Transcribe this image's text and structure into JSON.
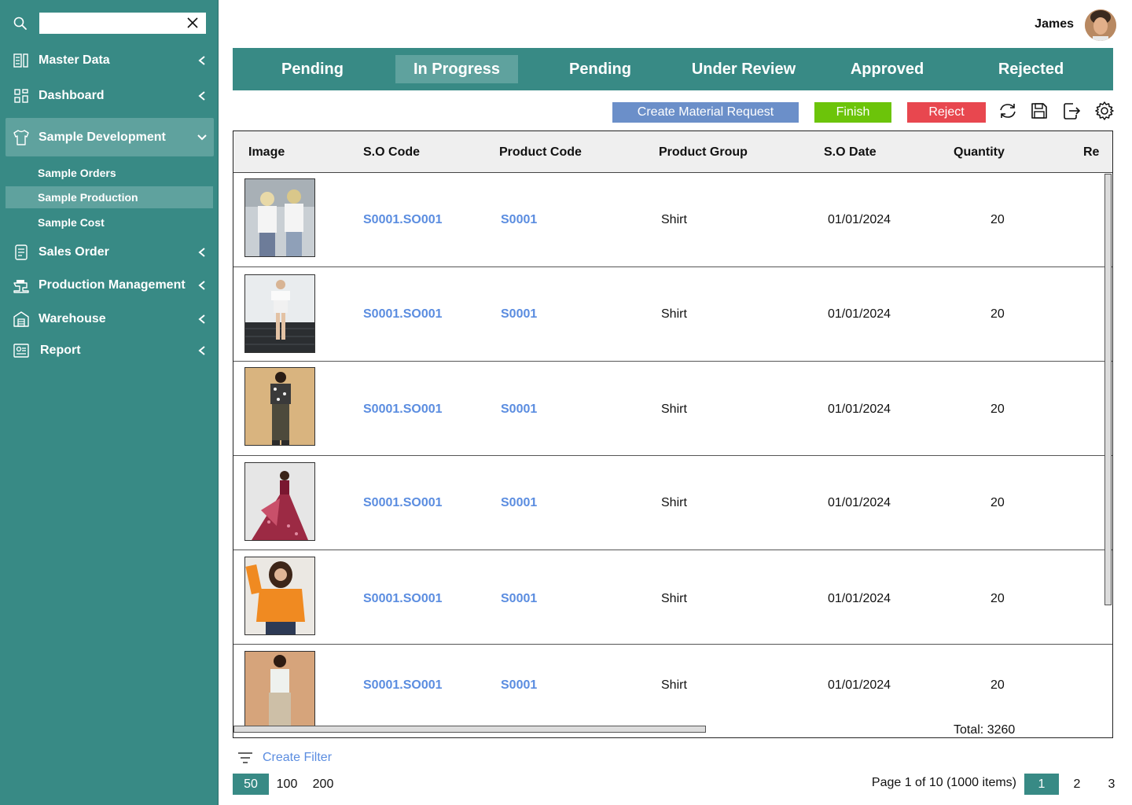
{
  "search": {
    "value": "",
    "placeholder": ""
  },
  "sidebar": {
    "items": [
      {
        "label": "Master Data",
        "icon": "master-data-icon"
      },
      {
        "label": "Dashboard",
        "icon": "dashboard-icon"
      },
      {
        "label": "Sample Development",
        "icon": "shirt-icon"
      },
      {
        "label": "Sales Order",
        "icon": "document-icon"
      },
      {
        "label": "Production Management",
        "icon": "sewing-machine-icon"
      },
      {
        "label": "Warehouse",
        "icon": "warehouse-icon"
      },
      {
        "label": "Report",
        "icon": "report-icon"
      }
    ],
    "sub_items": [
      {
        "label": "Sample Orders"
      },
      {
        "label": "Sample Production"
      },
      {
        "label": "Sample Cost"
      }
    ]
  },
  "header": {
    "user_name": "James"
  },
  "tabs": [
    {
      "label": "Pending"
    },
    {
      "label": "In Progress"
    },
    {
      "label": "Pending"
    },
    {
      "label": "Under Review"
    },
    {
      "label": "Approved"
    },
    {
      "label": "Rejected"
    }
  ],
  "actions": {
    "create_label": "Create Material Request",
    "finish_label": "Finish",
    "reject_label": "Reject"
  },
  "colors": {
    "brand": "#388a85",
    "brand_light": "#5fa29e",
    "create": "#6b8fc9",
    "finish": "#6cc40a",
    "reject": "#e8474f",
    "link": "#5b8de0"
  },
  "table": {
    "columns": [
      "Image",
      "S.O Code",
      "Product Code",
      "Product Group",
      "S.O Date",
      "Quantity",
      "Re"
    ],
    "rows": [
      {
        "so_code": "S0001.SO001",
        "product_code": "S0001",
        "group": "Shirt",
        "date": "01/01/2024",
        "qty": "20"
      },
      {
        "so_code": "S0001.SO001",
        "product_code": "S0001",
        "group": "Shirt",
        "date": "01/01/2024",
        "qty": "20"
      },
      {
        "so_code": "S0001.SO001",
        "product_code": "S0001",
        "group": "Shirt",
        "date": "01/01/2024",
        "qty": "20"
      },
      {
        "so_code": "S0001.SO001",
        "product_code": "S0001",
        "group": "Shirt",
        "date": "01/01/2024",
        "qty": "20"
      },
      {
        "so_code": "S0001.SO001",
        "product_code": "S0001",
        "group": "Shirt",
        "date": "01/01/2024",
        "qty": "20"
      },
      {
        "so_code": "S0001.SO001",
        "product_code": "S0001",
        "group": "Shirt",
        "date": "01/01/2024",
        "qty": "20"
      }
    ],
    "total": "Total: 3260"
  },
  "footer": {
    "filter_label": "Create Filter",
    "page_sizes": [
      "50",
      "100",
      "200"
    ],
    "page_info": "Page 1 of 10 (1000 items)",
    "pages": [
      "1",
      "2",
      "3"
    ]
  }
}
